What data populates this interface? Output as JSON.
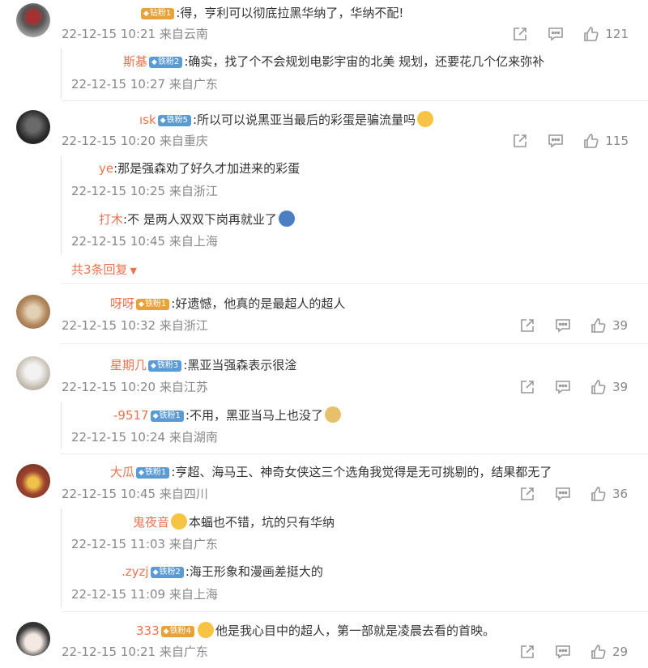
{
  "comments": [
    {
      "name": "",
      "badge": "钻粉1",
      "badge_color": "gold",
      "text": ":得，亨利可以彻底拉黑华纳了，华纳不配!",
      "meta": "22-12-15 10:21 来自云南",
      "likes": "121",
      "replies": [
        {
          "name": "斯基",
          "badge": "铁粉2",
          "badge_color": "blue",
          "text": ":确实，找了个不会规划电影宇宙的北美   规划，还要花几个亿来弥补",
          "meta": "22-12-15 10:27 来自广东"
        }
      ]
    },
    {
      "name": "ısk",
      "badge": "铁粉5",
      "badge_color": "blue",
      "text": ":所以可以说黑亚当最后的彩蛋是骗流量吗",
      "meta": "22-12-15 10:20 来自重庆",
      "likes": "115",
      "replies": [
        {
          "name": "ye",
          "text": ":那是强森劝了好久才加进来的彩蛋",
          "meta": "22-12-15 10:25 来自浙江"
        },
        {
          "name": "打木",
          "text": ":不 是两人双双下岗再就业了",
          "meta": "22-12-15 10:45 来自上海"
        }
      ],
      "more": "共3条回复"
    },
    {
      "name": "呀呀",
      "badge": "铁粉1",
      "badge_color": "gold",
      "text": ":好遗憾，他真的是最超人的超人",
      "meta": "22-12-15 10:32 来自浙江",
      "likes": "39"
    },
    {
      "name": "星期几",
      "badge": "铁粉3",
      "badge_color": "blue",
      "text": ":黑亚当强森表示很淦",
      "meta": "22-12-15 10:20 来自江苏",
      "likes": "39",
      "replies": [
        {
          "name": "-9517",
          "badge": "铁粉1",
          "badge_color": "blue",
          "text": ":不用，黑亚当马上也没了",
          "meta": "22-12-15 10:24 来自湖南"
        }
      ]
    },
    {
      "name": "大瓜",
      "badge": "铁粉1",
      "badge_color": "blue",
      "text": ":亨超、海马王、神奇女侠这三个选角我觉得是无可挑剔的，结果都无了",
      "meta": "22-12-15 10:45 来自四川",
      "likes": "36",
      "replies": [
        {
          "name": "鬼夜音",
          "text": "本蝠也不错，坑的只有华纳",
          "meta": "22-12-15 11:03 来自广东"
        },
        {
          "name": ".zyzj",
          "badge": "铁粉2",
          "badge_color": "blue",
          "text": ":海王形象和漫画差挺大的",
          "meta": "22-12-15 11:09 来自上海"
        }
      ]
    },
    {
      "name": "333",
      "badge": "铁粉4",
      "badge_color": "gold",
      "text": "他是我心目中的超人，第一部就是凌晨去看的首映。",
      "meta": "22-12-15 10:21 来自广东",
      "likes": "29"
    }
  ]
}
